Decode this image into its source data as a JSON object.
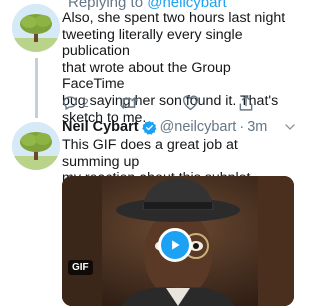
{
  "tweet1": {
    "reply_prefix": "Replying to",
    "reply_handle": "@neilcybart",
    "text_lines": [
      "Also, she spent two hours last night",
      "tweeting literally every single publication",
      "that wrote about the Group FaceTime",
      "bug saying her son found it. That's",
      "sketch to me."
    ],
    "actions": {
      "reply_icon": "reply-bubble-icon",
      "reply_count": "2",
      "retweet_icon": "retweet-icon",
      "like_icon": "heart-icon",
      "share_icon": "share-icon"
    }
  },
  "tweet2": {
    "name": "Neil Cybart",
    "verified_icon": "verified-badge-icon",
    "handle": "@neilcybart",
    "separator": "·",
    "time": "3m",
    "menu_icon": "chevron-down-icon",
    "text_lines": [
      "This GIF does a great job at summing up",
      "my reaction about this subplot."
    ],
    "media": {
      "badge": "GIF",
      "play_icon": "play-icon"
    }
  },
  "colors": {
    "accent": "#1da1f2",
    "secondary_text": "#657786",
    "thread_line": "#c4cfd6"
  }
}
